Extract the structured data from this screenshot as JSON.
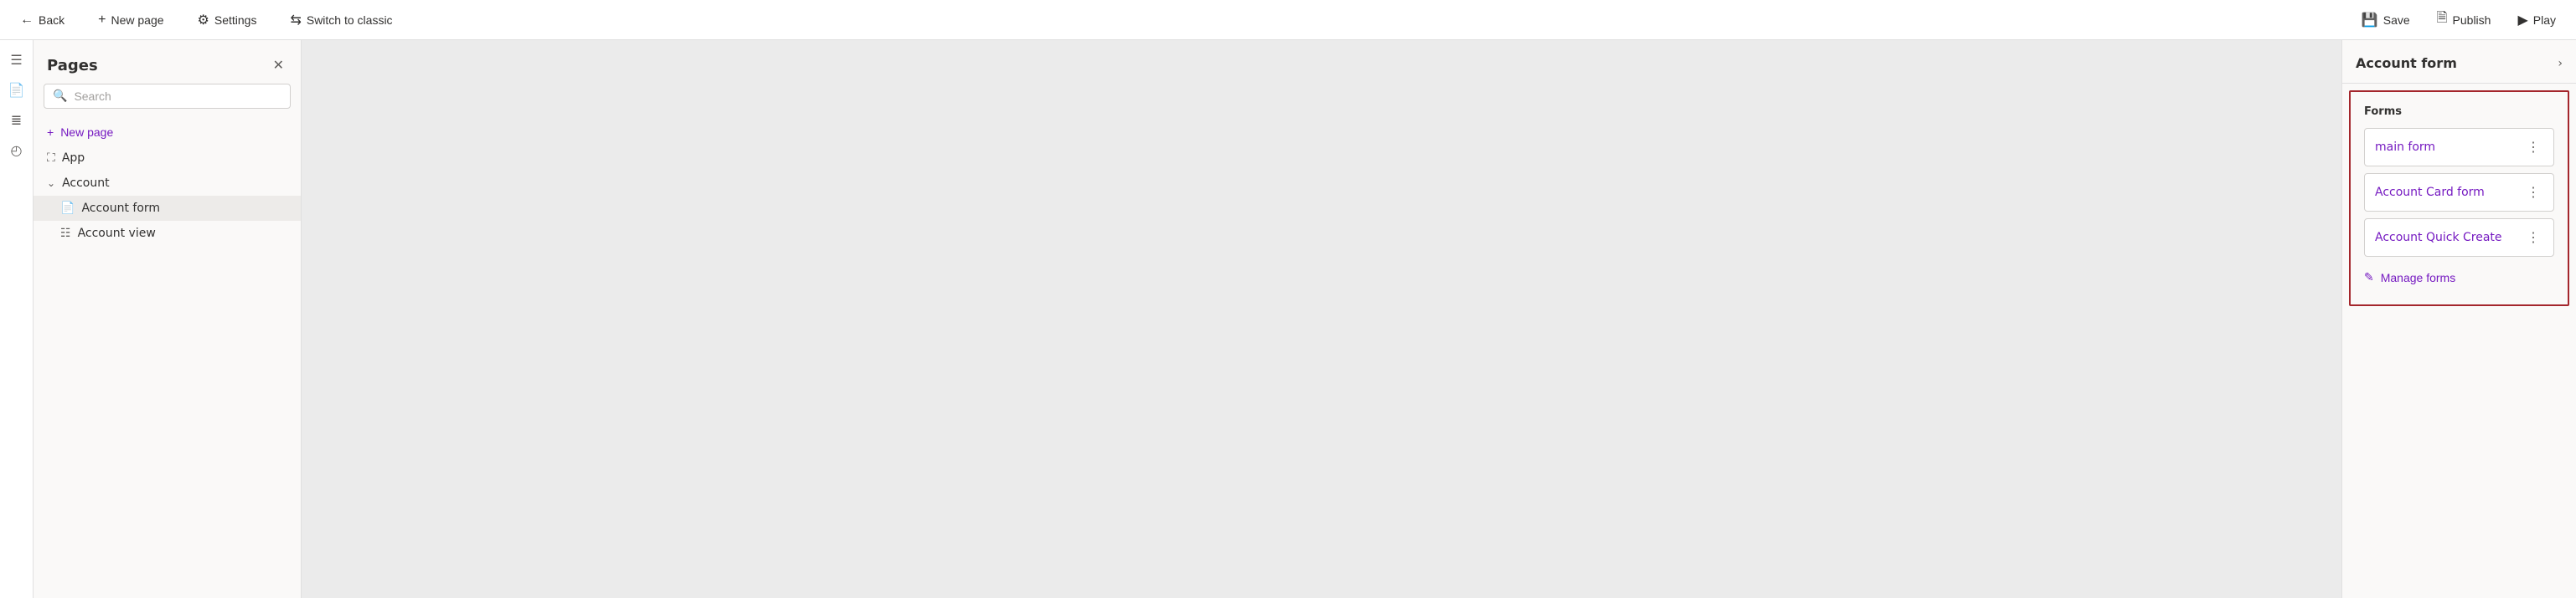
{
  "topbar": {
    "back_label": "Back",
    "new_page_label": "New page",
    "settings_label": "Settings",
    "switch_label": "Switch to classic",
    "save_label": "Save",
    "publish_label": "Publish",
    "play_label": "Play"
  },
  "sidebar": {
    "title": "Pages",
    "search_placeholder": "Search",
    "new_page_label": "New page",
    "tree": {
      "app_label": "App",
      "account_label": "Account",
      "account_form_label": "Account form",
      "account_view_label": "Account view"
    }
  },
  "right_panel": {
    "title": "Account form",
    "forms_section_label": "Forms",
    "items": [
      {
        "name": "main form"
      },
      {
        "name": "Account Card form"
      },
      {
        "name": "Account Quick Create"
      }
    ],
    "manage_forms_label": "Manage forms"
  }
}
